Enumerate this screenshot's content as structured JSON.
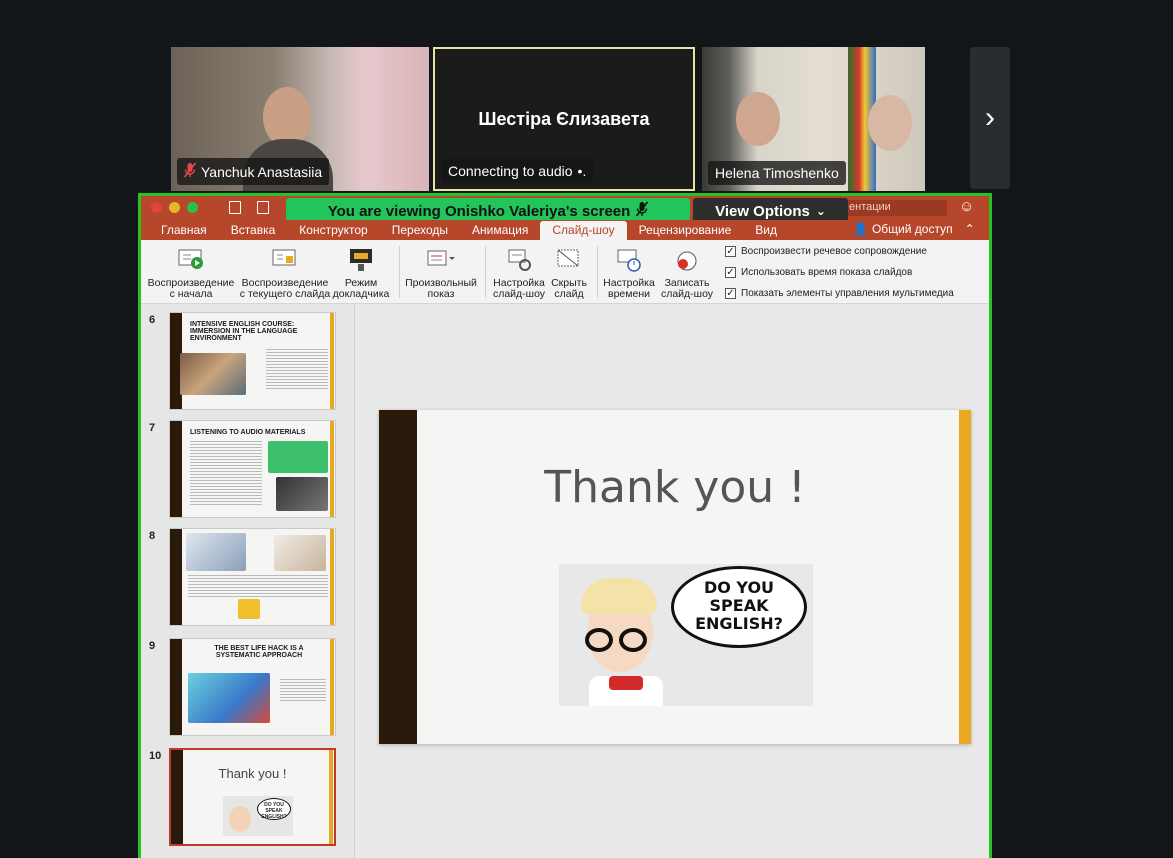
{
  "participants": [
    {
      "name": "Yanchuk Anastasiia",
      "muted": true
    },
    {
      "name": "Шестіра Єлизавета",
      "status": "Connecting to audio"
    },
    {
      "name": "Helena Timoshenko"
    }
  ],
  "share": {
    "banner": "You are viewing  Onishko Valeriya's screen",
    "view_options": "View Options",
    "search_partial": "ентации"
  },
  "ppt": {
    "tabs": [
      "Главная",
      "Вставка",
      "Конструктор",
      "Переходы",
      "Анимация",
      "Слайд-шоу",
      "Рецензирование",
      "Вид"
    ],
    "active_tab": "Слайд-шоу",
    "share_label": "Общий доступ",
    "toolbar": [
      {
        "id": "play-from-start",
        "l1": "Воспроизведение",
        "l2": "с начала"
      },
      {
        "id": "play-from-current",
        "l1": "Воспроизведение",
        "l2": "с текущего слайда"
      },
      {
        "id": "presenter-mode",
        "l1": "Режим",
        "l2": "докладчика"
      },
      {
        "id": "custom-show",
        "l1": "Произвольный",
        "l2": "показ"
      },
      {
        "id": "setup-slideshow",
        "l1": "Настройка",
        "l2": "слайд-шоу"
      },
      {
        "id": "hide-slide",
        "l1": "Скрыть",
        "l2": "слайд"
      },
      {
        "id": "rehearse-timings",
        "l1": "Настройка",
        "l2": "времени"
      },
      {
        "id": "record-slideshow",
        "l1": "Записать",
        "l2": "слайд-шоу"
      }
    ],
    "checkboxes": [
      "Воспроизвести речевое сопровождение",
      "Использовать время показа слайдов",
      "Показать элементы управления мультимедиа"
    ],
    "thumbnails": [
      {
        "num": "6",
        "title": "INTENSIVE ENGLISH COURSE: IMMERSION IN THE LANGUAGE ENVIRONMENT"
      },
      {
        "num": "7",
        "title": "LISTENING TO AUDIO MATERIALS"
      },
      {
        "num": "8",
        "title": ""
      },
      {
        "num": "9",
        "title": "THE BEST LIFE HACK IS A SYSTEMATIC APPROACH"
      },
      {
        "num": "10",
        "title": "Thank you !"
      }
    ],
    "slide": {
      "title": "Thank you !",
      "bubble_text": "DO YOU SPEAK ENGLISH?"
    }
  }
}
